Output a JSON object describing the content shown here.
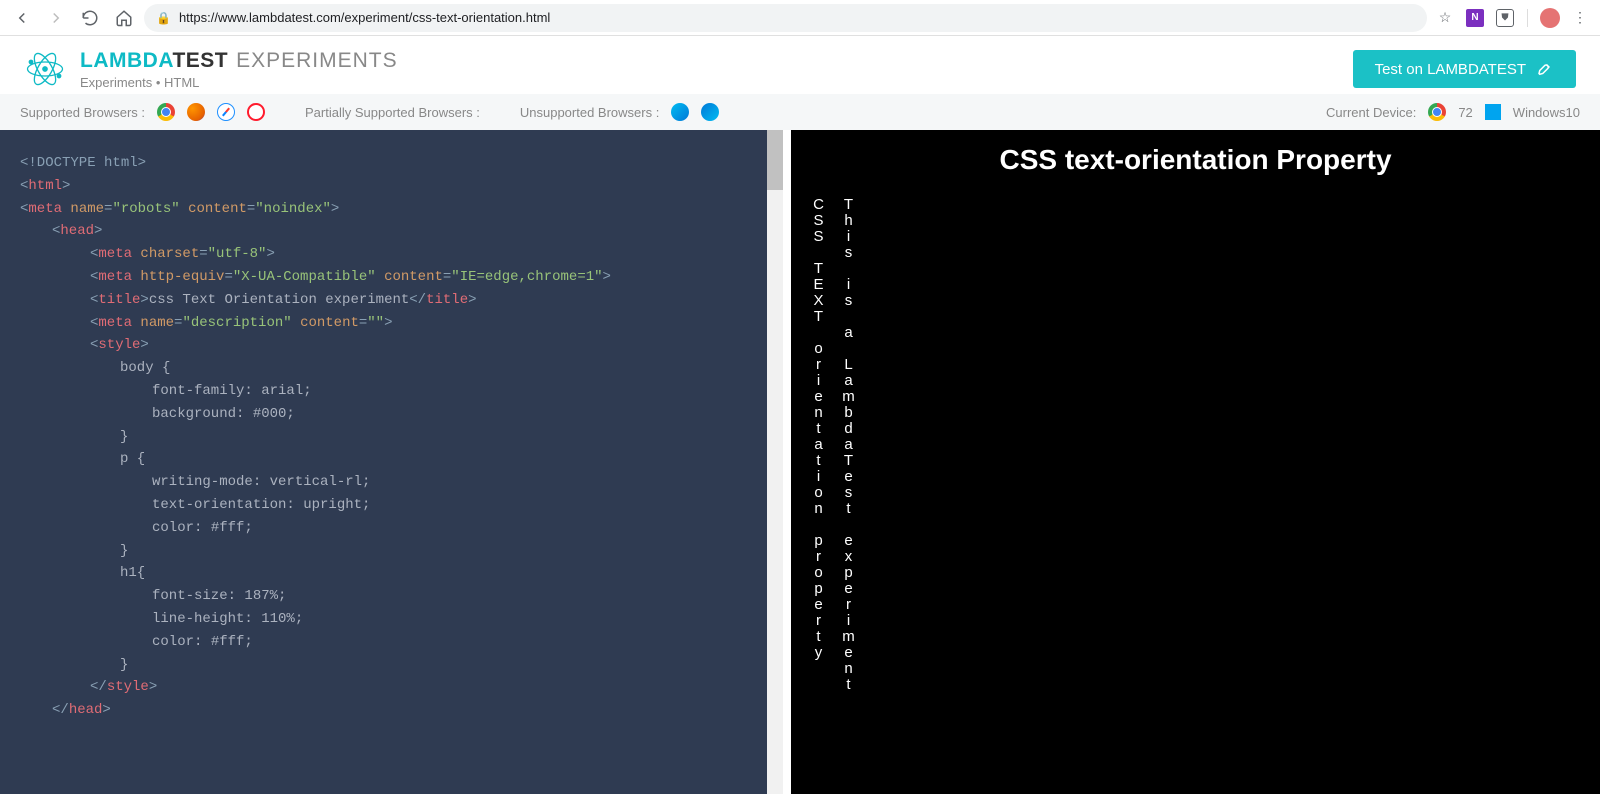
{
  "browser": {
    "url": "https://www.lambdatest.com/experiment/css-text-orientation.html"
  },
  "header": {
    "brand_lambda": "LAMBDA",
    "brand_test": "TEST",
    "brand_experiments": "EXPERIMENTS",
    "breadcrumb": "Experiments • HTML",
    "test_button": "Test on LAMBDATEST"
  },
  "support": {
    "supported_label": "Supported Browsers :",
    "partial_label": "Partially Supported Browsers :",
    "unsupported_label": "Unsupported Browsers :",
    "device_label": "Current Device:",
    "device_version": "72",
    "device_os": "Windows10"
  },
  "code": {
    "l1": "<!DOCTYPE html>",
    "l2_open": "<",
    "l2_tag": "html",
    "l2_close": ">",
    "l3_open": "<",
    "l3_tag": "meta",
    "l3_a1": "name",
    "l3_v1": "\"robots\"",
    "l3_a2": "content",
    "l3_v2": "\"noindex\"",
    "l3_close": ">",
    "l4_open": "<",
    "l4_tag": "head",
    "l4_close": ">",
    "l5_open": "<",
    "l5_tag": "meta",
    "l5_a1": "charset",
    "l5_v1": "\"utf-8\"",
    "l5_close": ">",
    "l6_open": "<",
    "l6_tag": "meta",
    "l6_a1": "http-equiv",
    "l6_v1": "\"X-UA-Compatible\"",
    "l6_a2": "content",
    "l6_v2": "\"IE=edge,chrome=1\"",
    "l6_close": ">",
    "l7_open": "<",
    "l7_tag": "title",
    "l7_close": ">",
    "l7_text": "css Text Orientation experiment",
    "l7_copen": "</",
    "l7_ctag": "title",
    "l7_cclose": ">",
    "l8_open": "<",
    "l8_tag": "meta",
    "l8_a1": "name",
    "l8_v1": "\"description\"",
    "l8_a2": "content",
    "l8_v2": "\"\"",
    "l8_close": ">",
    "l9_open": "<",
    "l9_tag": "style",
    "l9_close": ">",
    "l10": "body {",
    "l11_p": "font-family",
    "l11_v": ": arial;",
    "l12_p": "background",
    "l12_v": ": #000;",
    "l13": "}",
    "l14": "p {",
    "l15_p": "writing-mode",
    "l15_v": ": vertical-rl;",
    "l16_p": "text-orientation",
    "l16_v": ": upright;",
    "l17_p": "color",
    "l17_v": ": #fff;",
    "l18": "}",
    "l19": "h1{",
    "l20_p": "font-size",
    "l20_v": ": 187%;",
    "l21_p": "line-height",
    "l21_v": ": 110%;",
    "l22_p": "color",
    "l22_v": ": #fff;",
    "l23": "}",
    "l24_open": "</",
    "l24_tag": "style",
    "l24_close": ">",
    "l25_open": "</",
    "l25_tag": "head",
    "l25_close": ">"
  },
  "preview": {
    "heading": "CSS text-orientation Property",
    "p1": "CSS TEXT orientation property",
    "p2": "This is a LambdaTest experiment"
  }
}
